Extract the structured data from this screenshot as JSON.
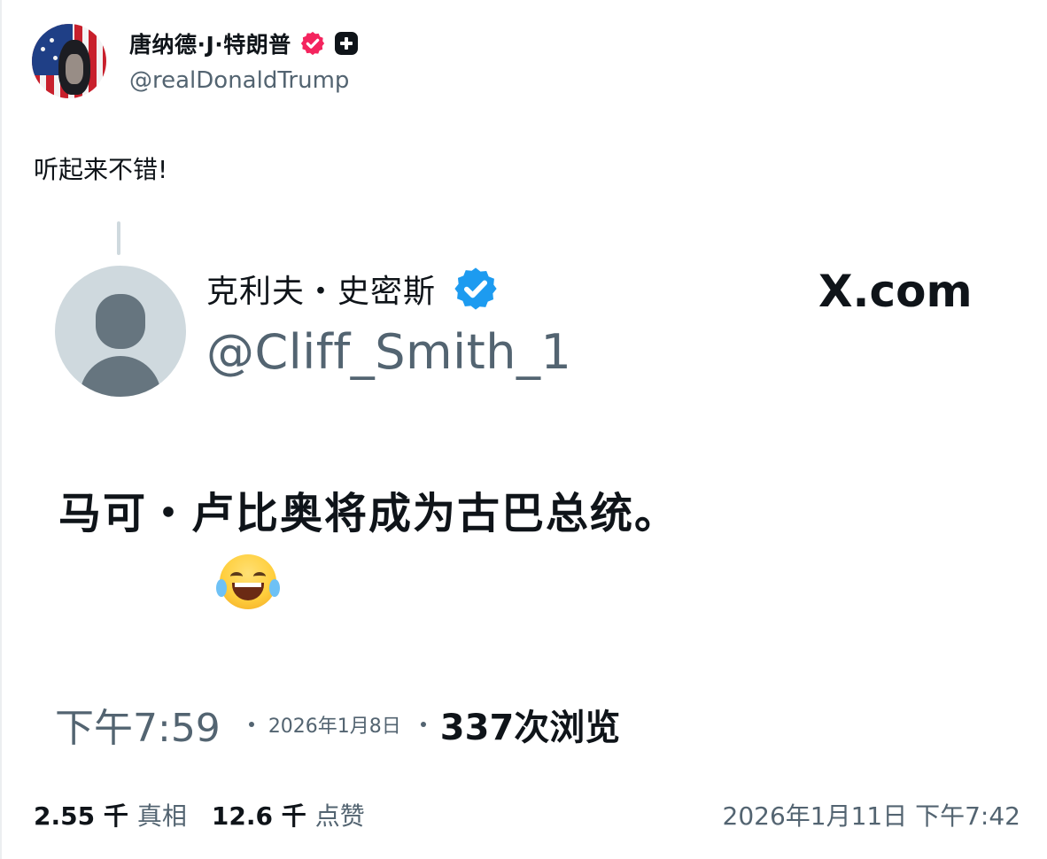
{
  "author": {
    "display_name": "唐纳德·J·特朗普",
    "handle": "@realDonaldTrump",
    "avatar_icon": "flag-portrait-avatar",
    "verified_badge_color": "#f4245e",
    "badge_icon": "plus-badge-icon"
  },
  "post": {
    "text": "听起来不错!"
  },
  "quoted": {
    "display_name": "克利夫・史密斯",
    "handle": "@Cliff_Smith_1",
    "verified_badge_color": "#1d9bf0",
    "brand": "X.com",
    "text": "马可・卢比奥将成为古巴总统。",
    "emoji": "laughing-tears-emoji",
    "time": "下午7:59",
    "date": "2026年1月8日",
    "views": "337次浏览"
  },
  "footer": {
    "stats": [
      {
        "value": "2.55 千",
        "label": "真相"
      },
      {
        "value": "12.6 千",
        "label": "点赞"
      }
    ],
    "timestamp": "2026年1月11日 下午7:42"
  }
}
